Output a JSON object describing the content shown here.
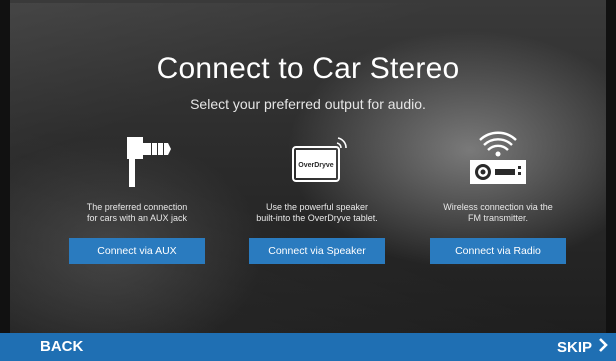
{
  "title": "Connect to Car Stereo",
  "subtitle": "Select your preferred output for audio.",
  "options": [
    {
      "icon": "aux-jack-icon",
      "description_line1": "The preferred connection",
      "description_line2": "for cars with an AUX jack",
      "button_label": "Connect via AUX"
    },
    {
      "icon": "tablet-speaker-icon",
      "tablet_logo_text": "OverDryve",
      "description_line1": "Use the powerful speaker",
      "description_line2": "built-into the OverDryve tablet.",
      "button_label": "Connect via Speaker"
    },
    {
      "icon": "radio-transmitter-icon",
      "description_line1": "Wireless connection via the",
      "description_line2": "FM transmitter.",
      "button_label": "Connect via Radio"
    }
  ],
  "footer": {
    "back_label": "BACK",
    "skip_label": "SKIP"
  },
  "colors": {
    "button": "#2a7bbf",
    "footer": "#1f6fb3"
  }
}
